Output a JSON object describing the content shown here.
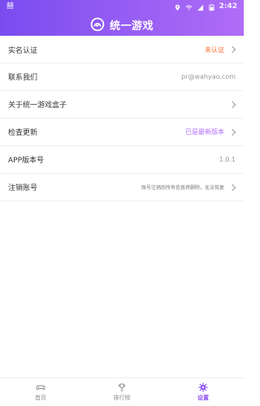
{
  "status_bar": {
    "left_text": "囍",
    "time": "2:42"
  },
  "header": {
    "title": "统一游戏"
  },
  "settings": {
    "items": [
      {
        "label": "实名认证",
        "value": "未认证",
        "value_color": "#ff6b2c"
      },
      {
        "label": "联系我们",
        "value": "pr@wahyao.com",
        "value_color": "#999999"
      },
      {
        "label": "关于统一游戏盒子",
        "value": "",
        "value_color": "#999999"
      },
      {
        "label": "检查更新",
        "value": "已是最新版本",
        "value_color": "#b26bf8"
      },
      {
        "label": "APP版本号",
        "value": "1.0.1",
        "value_color": "#999999"
      },
      {
        "label": "注销账号",
        "value": "账号注销后所有信息将删除，无法恢复",
        "value_color": "#777777"
      }
    ]
  },
  "bottom_nav": {
    "items": [
      {
        "label": "首页"
      },
      {
        "label": "排行榜"
      },
      {
        "label": "设置"
      }
    ]
  },
  "colors": {
    "accent": "#8f55f2",
    "header_gradient_start": "#7a4cf0",
    "header_gradient_end": "#b06cf6",
    "divider": "#efefef"
  }
}
